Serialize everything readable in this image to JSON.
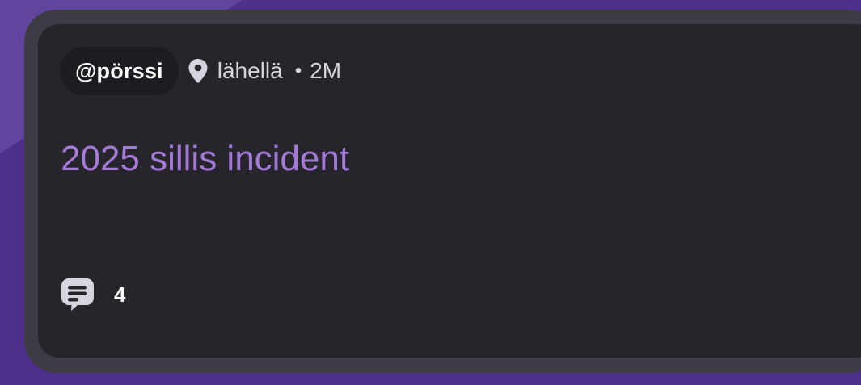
{
  "post": {
    "username": "@pörssi",
    "location": "lähellä",
    "separator": "•",
    "time": "2M",
    "title": "2025 sillis incident",
    "comment_count": "4"
  },
  "icons": {
    "location": "map-pin-icon",
    "comments": "comment-bubble-icon"
  },
  "colors": {
    "background": "#4f2f8c",
    "card_frame": "#3d3c44",
    "card": "#26252b",
    "chip": "#1d1c21",
    "title_accent": "#a57ad9",
    "meta_text": "#d6d5dd"
  }
}
